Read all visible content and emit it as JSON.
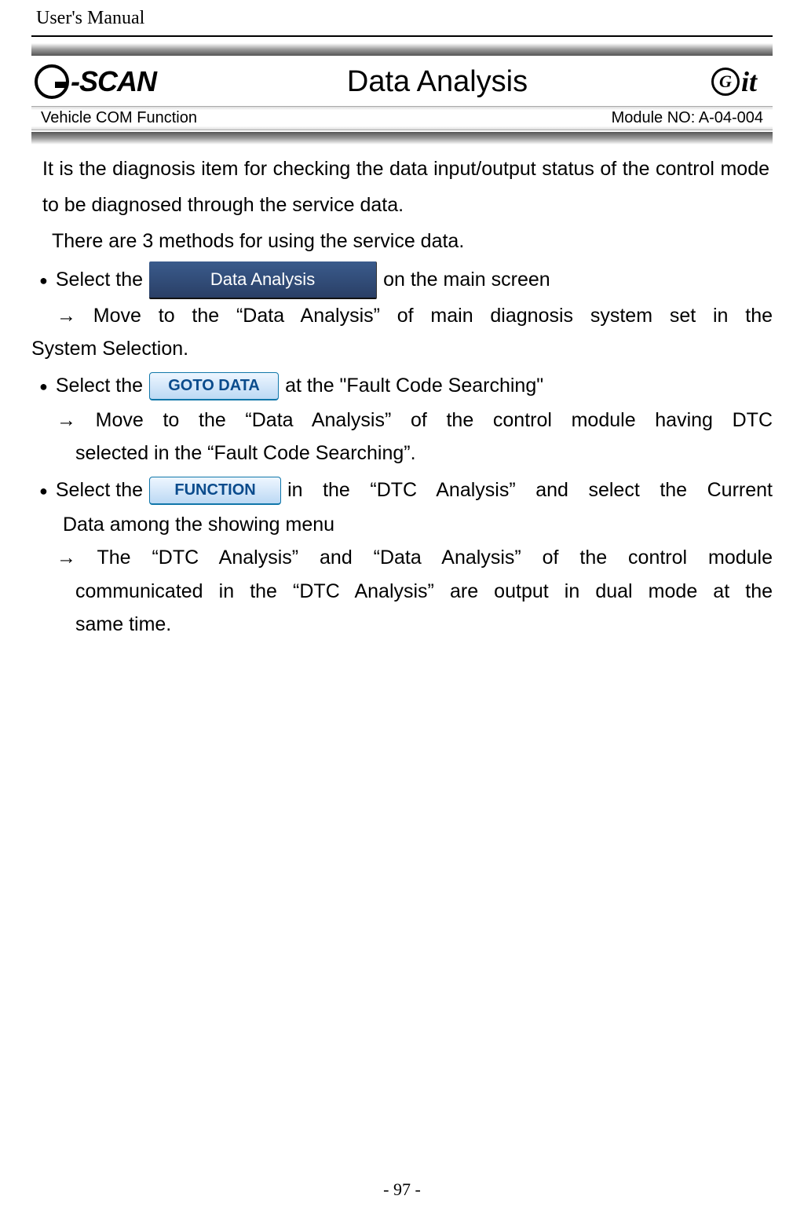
{
  "header": {
    "manual_title": "User's Manual"
  },
  "banner": {
    "logo_left_text": "-SCAN",
    "page_title": "Data Analysis",
    "logo_right_text": "it",
    "sub_left": "Vehicle COM Function",
    "sub_right": "Module NO: A-04-004"
  },
  "content": {
    "intro1": "It is the diagnosis item for checking the data input/output status of the control mode to be diagnosed through the service data.",
    "intro2": "There are 3 methods for using the service data.",
    "bullet1_pre": "Select the",
    "bullet1_btn": "Data Analysis",
    "bullet1_post": "on the main screen",
    "bullet1_arrow": "→ Move to the \"Data Analysis\" of main diagnosis system set in the System Selection.",
    "bullet2_pre": "Select the",
    "bullet2_btn": "GOTO DATA",
    "bullet2_post": "at the \"Fault Code Searching\"",
    "bullet2_arrow": "→ Move to the \"Data Analysis\" of the control module having DTC selected in the \"Fault Code Searching\".",
    "bullet3_pre": "Select the",
    "bullet3_btn": "FUNCTION",
    "bullet3_post": "in the \"DTC Analysis\" and select the Current Data among the showing menu",
    "bullet3_data_line": "Data among the showing menu",
    "bullet3_arrow": "→ The \"DTC Analysis\" and \"Data Analysis\" of the control module communicated in the \"DTC Analysis\" are output in dual mode at the same time."
  },
  "footer": {
    "page_number": "- 97 -"
  }
}
